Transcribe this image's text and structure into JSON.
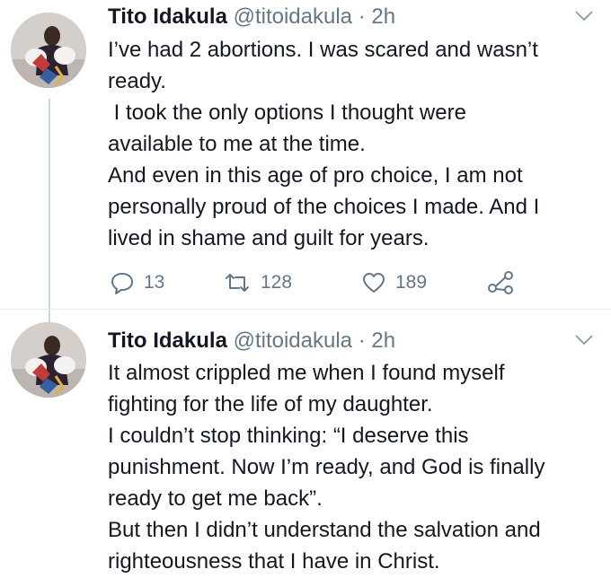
{
  "tweets": [
    {
      "author_name": "Tito Idakula",
      "handle": "@titoidakula",
      "separator": "·",
      "time": "2h",
      "lines": [
        "I’ve had 2 abortions. I was scared and wasn’t",
        "ready.",
        " I took the only options I thought were",
        "available to me at the time.",
        "And even in this age of pro choice, I am not",
        "personally proud of the choices I made. And I",
        "lived in shame and guilt for years."
      ],
      "reply_count": "13",
      "retweet_count": "128",
      "like_count": "189"
    },
    {
      "author_name": "Tito Idakula",
      "handle": "@titoidakula",
      "separator": "·",
      "time": "2h",
      "lines": [
        "It almost crippled me when I found myself",
        "fighting for the life of my daughter.",
        "I couldn’t stop thinking: “I deserve this",
        "punishment. Now I’m ready, and God is finally",
        "ready to get me back”.",
        "But then I didn’t understand the salvation and",
        "righteousness that I have in Christ."
      ]
    }
  ],
  "icons": {
    "caret": "chevron-down-icon",
    "reply": "reply-icon",
    "retweet": "retweet-icon",
    "like": "heart-icon",
    "share": "share-icon"
  },
  "colors": {
    "text": "#141823",
    "secondary": "#657786",
    "thread_line": "#ccd6dd"
  }
}
